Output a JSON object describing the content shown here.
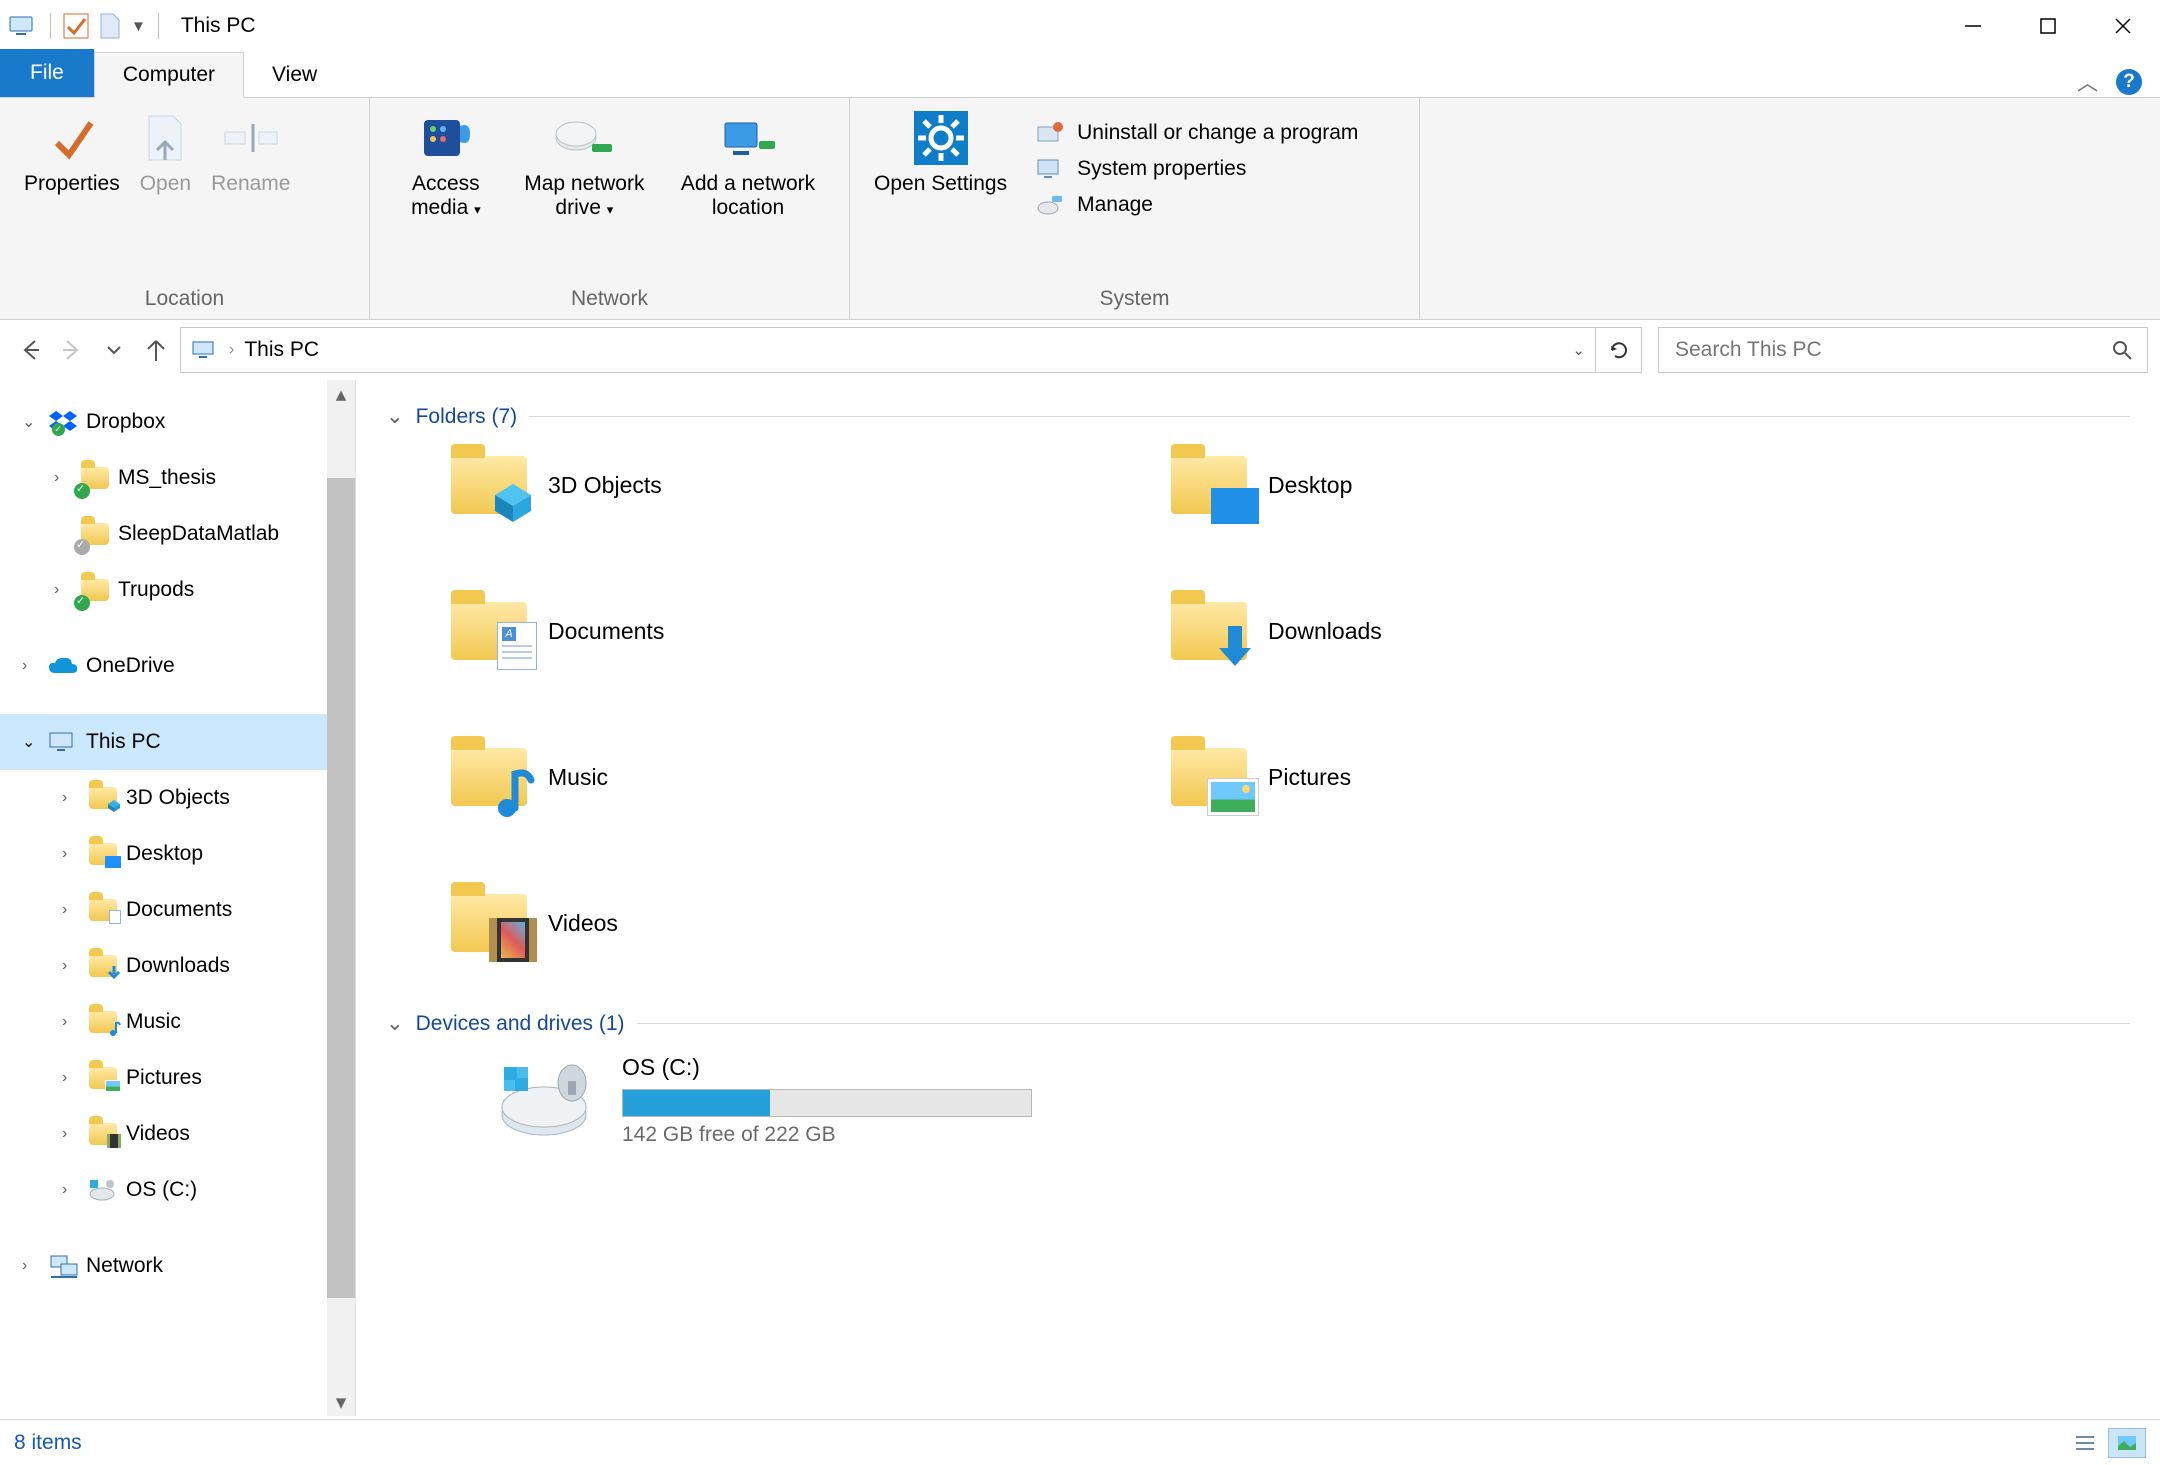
{
  "window": {
    "title": "This PC"
  },
  "tabs": {
    "file": "File",
    "computer": "Computer",
    "view": "View"
  },
  "ribbon": {
    "location": {
      "label": "Location",
      "properties": "Properties",
      "open": "Open",
      "rename": "Rename"
    },
    "network": {
      "label": "Network",
      "access_media": "Access media",
      "map_drive": "Map network drive",
      "add_location": "Add a network location"
    },
    "system": {
      "label": "System",
      "open_settings": "Open Settings",
      "uninstall": "Uninstall or change a program",
      "sys_props": "System properties",
      "manage": "Manage"
    }
  },
  "addressbar": {
    "location": "This PC"
  },
  "search": {
    "placeholder": "Search This PC"
  },
  "nav": {
    "dropbox": "Dropbox",
    "ms_thesis": "MS_thesis",
    "sleepdata": "SleepDataMatlab",
    "trupods": "Trupods",
    "onedrive": "OneDrive",
    "thispc": "This PC",
    "obj3d": "3D Objects",
    "desktop": "Desktop",
    "documents": "Documents",
    "downloads": "Downloads",
    "music": "Music",
    "pictures": "Pictures",
    "videos": "Videos",
    "osc": "OS (C:)",
    "network": "Network"
  },
  "sections": {
    "folders": "Folders (7)",
    "drives": "Devices and drives (1)"
  },
  "folders": {
    "obj3d": "3D Objects",
    "desktop": "Desktop",
    "documents": "Documents",
    "downloads": "Downloads",
    "music": "Music",
    "pictures": "Pictures",
    "videos": "Videos"
  },
  "drive": {
    "name": "OS (C:)",
    "free_text": "142 GB free of 222 GB",
    "used_pct": 36
  },
  "statusbar": {
    "count": "8 items"
  }
}
